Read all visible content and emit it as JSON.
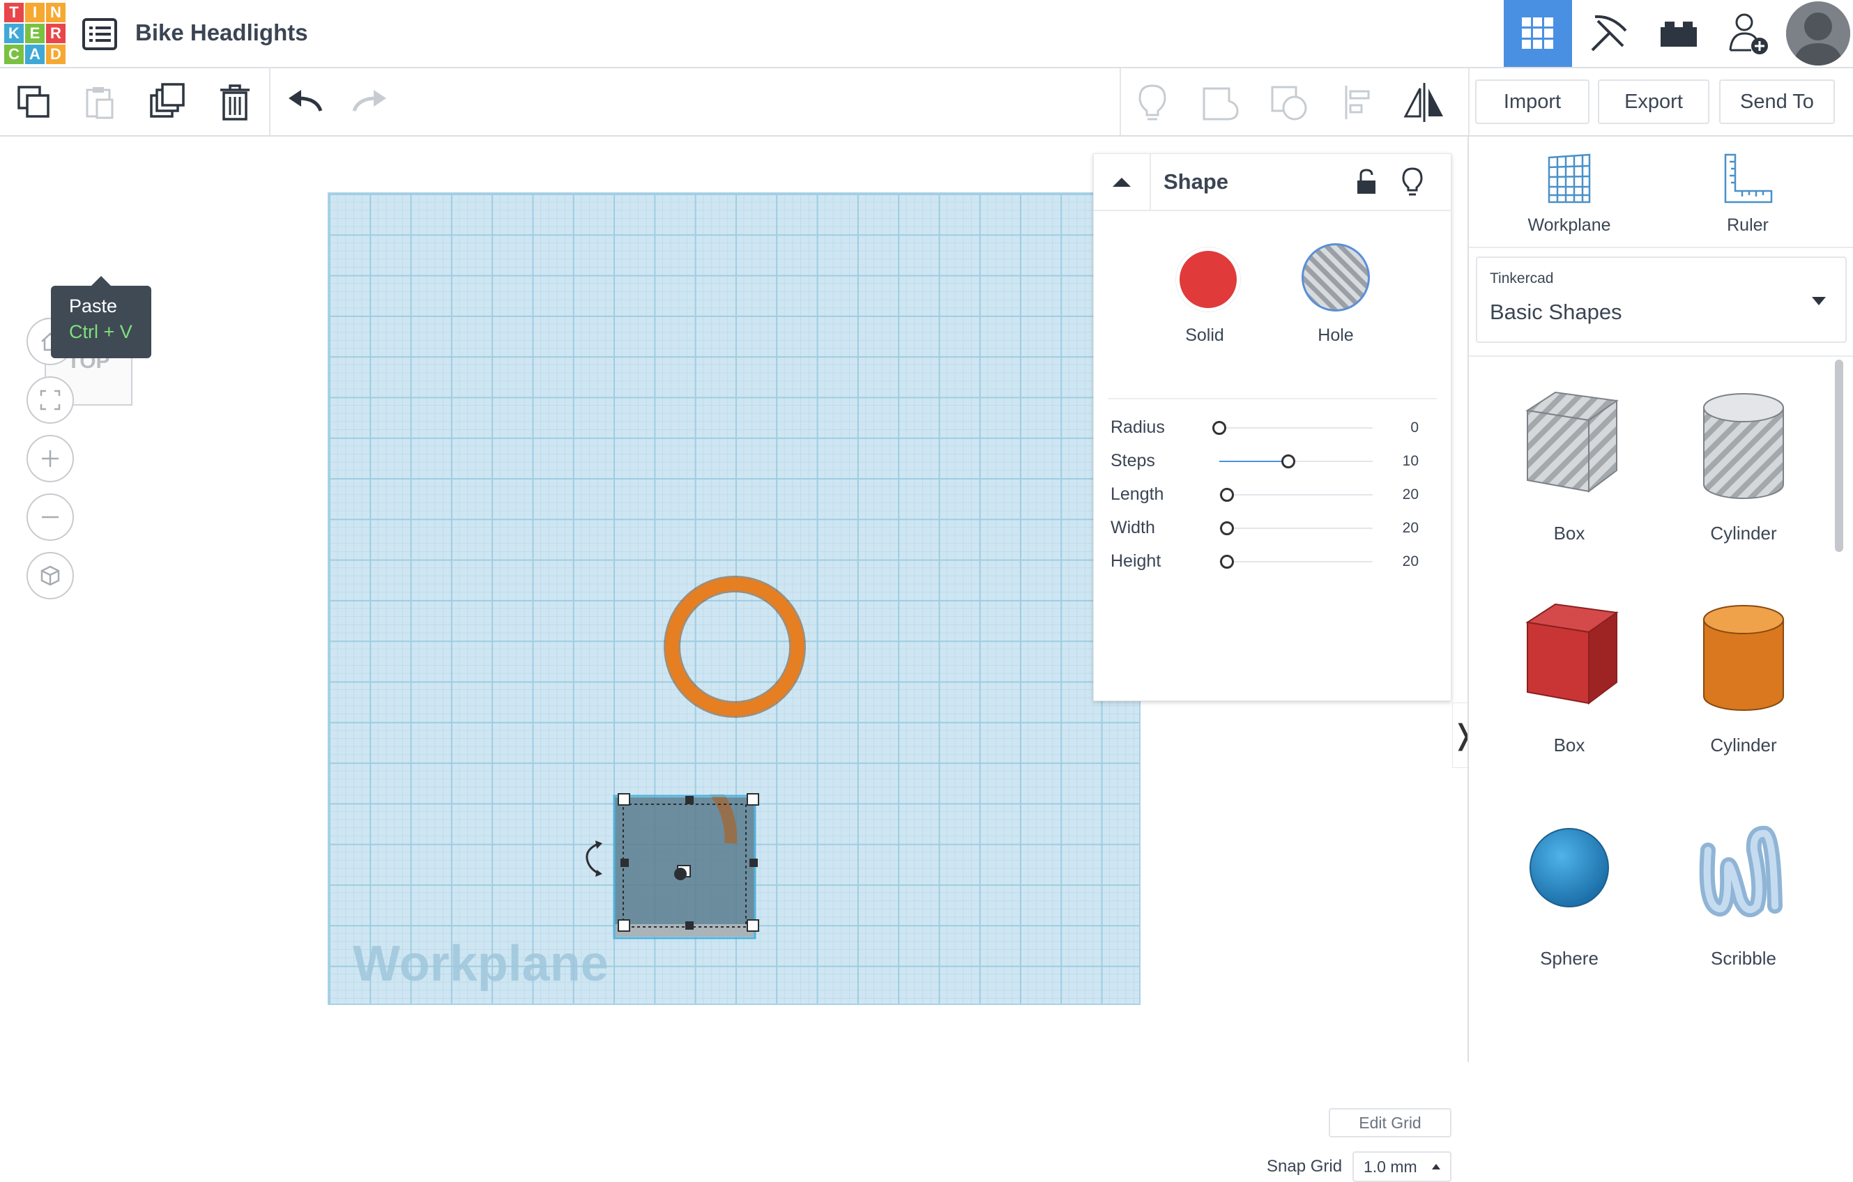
{
  "app": {
    "logo_letters": [
      "T",
      "I",
      "N",
      "K",
      "E",
      "R",
      "C",
      "A",
      "D"
    ],
    "logo_colors": [
      "#e8464b",
      "#f6a830",
      "#f6a830",
      "#3fa9d6",
      "#7ac142",
      "#e8464b",
      "#7ac142",
      "#3fa9d6",
      "#f6a830"
    ],
    "design_title": "Bike Headlights"
  },
  "toolbar": {
    "import_label": "Import",
    "export_label": "Export",
    "send_to_label": "Send To"
  },
  "tooltip": {
    "title": "Paste",
    "shortcut": "Ctrl + V"
  },
  "viewcube": {
    "face_label": "TOP"
  },
  "workplane": {
    "label": "Workplane"
  },
  "inspector": {
    "title": "Shape",
    "solid_label": "Solid",
    "hole_label": "Hole",
    "solid_color": "#e03a3a",
    "properties": [
      {
        "label": "Radius",
        "value": "0",
        "fraction": 0.0
      },
      {
        "label": "Steps",
        "value": "10",
        "fraction": 0.45
      },
      {
        "label": "Length",
        "value": "20",
        "fraction": 0.05
      },
      {
        "label": "Width",
        "value": "20",
        "fraction": 0.05
      },
      {
        "label": "Height",
        "value": "20",
        "fraction": 0.05
      }
    ]
  },
  "grid": {
    "edit_label": "Edit Grid",
    "snap_label": "Snap Grid",
    "snap_value": "1.0 mm"
  },
  "right_panel": {
    "workplane_label": "Workplane",
    "ruler_label": "Ruler",
    "library_category": "Tinkercad",
    "library_name": "Basic Shapes",
    "shapes": [
      {
        "label": "Box",
        "kind": "box-hole"
      },
      {
        "label": "Cylinder",
        "kind": "cylinder-hole"
      },
      {
        "label": "Box",
        "kind": "box"
      },
      {
        "label": "Cylinder",
        "kind": "cylinder"
      },
      {
        "label": "Sphere",
        "kind": "sphere"
      },
      {
        "label": "Scribble",
        "kind": "scribble"
      }
    ]
  }
}
